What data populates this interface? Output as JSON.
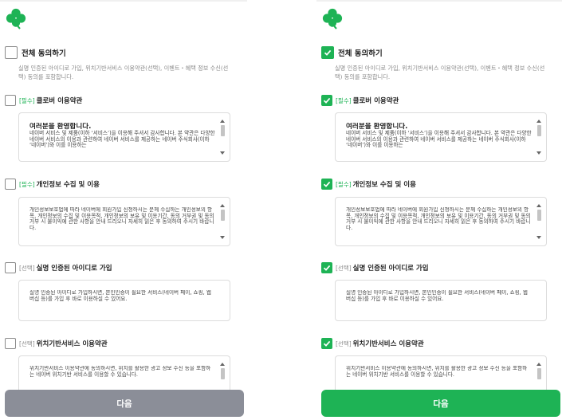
{
  "colors": {
    "brand_green": "#1eb355",
    "disabled_button": "#8b8e98"
  },
  "left": {
    "agree_all": {
      "label": "전체 동의하기",
      "checked": false,
      "description": "실명 인증된 아이디로 가입, 위치기반서비스 이용약관(선택), 이벤트・혜택 정보 수신(선택) 동의를 포함합니다."
    },
    "items": [
      {
        "tag": "[필수]",
        "title": "클로버 이용약관",
        "checked": false,
        "heading": "여러분을 환영합니다.",
        "text": "네이버 서비스 및 제품(이하 ‘서비스’)을 이용해 주셔서 감사합니다. 본 약관은 다양한 네이버 서비스의 이용과 관련하여 네이버 서비스를 제공하는 네이버 주식회사(이하 ‘네이버’)와 이를 이용하는"
      },
      {
        "tag": "[필수]",
        "title": "개인정보 수집 및 이용",
        "checked": false,
        "heading": "",
        "text": "개인정보보호법에 따라 네이버에 회원가입 신청하시는 분께 수집하는 개인정보의 항목, 개인정보의 수집 및 이용목적, 개인정보의 보유 및 이용기간, 동의 거부권 및 동의 거부 시 불이익에 관한 사항을 안내 드리오니 자세히 읽은 후 동의하여 주시기 바랍니다."
      },
      {
        "tag": "[선택]",
        "title": "실명 인증된 아이디로 가입",
        "checked": false,
        "heading": "",
        "text": "실명 인증된 아이디로 가입하시면, 본인인증이 필요한 서비스(네이버 페이, 쇼핑, 웹버십 등)를 가입 후 바로 이용하실 수 있어요."
      },
      {
        "tag": "[선택]",
        "title": "위치기반서비스 이용약관",
        "checked": false,
        "heading": "",
        "text": "위치기반서비스 이용약관에 동의하시면, 위치를 활용한 광고 정보 수신 등을 포함하는 네이버 위치기반 서비스를 이용할 수 있습니다."
      }
    ],
    "next_label": "다음"
  },
  "right": {
    "agree_all": {
      "label": "전체 동의하기",
      "checked": true,
      "description": "실명 인증된 아이디로 가입, 위치기반서비스 이용약관(선택), 이벤트・혜택 정보 수신(선택) 동의를 포함합니다."
    },
    "items": [
      {
        "tag": "[필수]",
        "title": "클로버 이용약관",
        "checked": true,
        "heading": "여러분을 환영합니다.",
        "text": "네이버 서비스 및 제품(이하 ‘서비스’)을 이용해 주셔서 감사합니다. 본 약관은 다양한 네이버 서비스의 이용과 관련하여 네이버 서비스를 제공하는 네이버 주식회사(이하 ‘네이버’)와 이를 이용하는"
      },
      {
        "tag": "[필수]",
        "title": "개인정보 수집 및 이용",
        "checked": true,
        "heading": "",
        "text": "개인정보보호법에 따라 네이버에 회원가입 신청하시는 분께 수집하는 개인정보의 항목, 개인정보의 수집 및 이용목적, 개인정보의 보유 및 이용기간, 동의 거부권 및 동의 거부 시 불이익에 관한 사항을 안내 드리오니 자세히 읽은 후 동의하여 주시기 바랍니다."
      },
      {
        "tag": "[선택]",
        "title": "실명 인증된 아이디로 가입",
        "checked": true,
        "heading": "",
        "text": "실명 인증된 아이디로 가입하시면, 본인인증이 필요한 서비스(네이버 페이, 쇼핑, 웹버십 등)를 가입 후 바로 이용하실 수 있어요."
      },
      {
        "tag": "[선택]",
        "title": "위치기반서비스 이용약관",
        "checked": true,
        "heading": "",
        "text": "위치기반서비스 이용약관에 동의하시면, 위치를 활용한 광고 정보 수신 등을 포함하는 네이버 위치기반 서비스를 이용할 수 있습니다."
      }
    ],
    "next_label": "다음"
  }
}
